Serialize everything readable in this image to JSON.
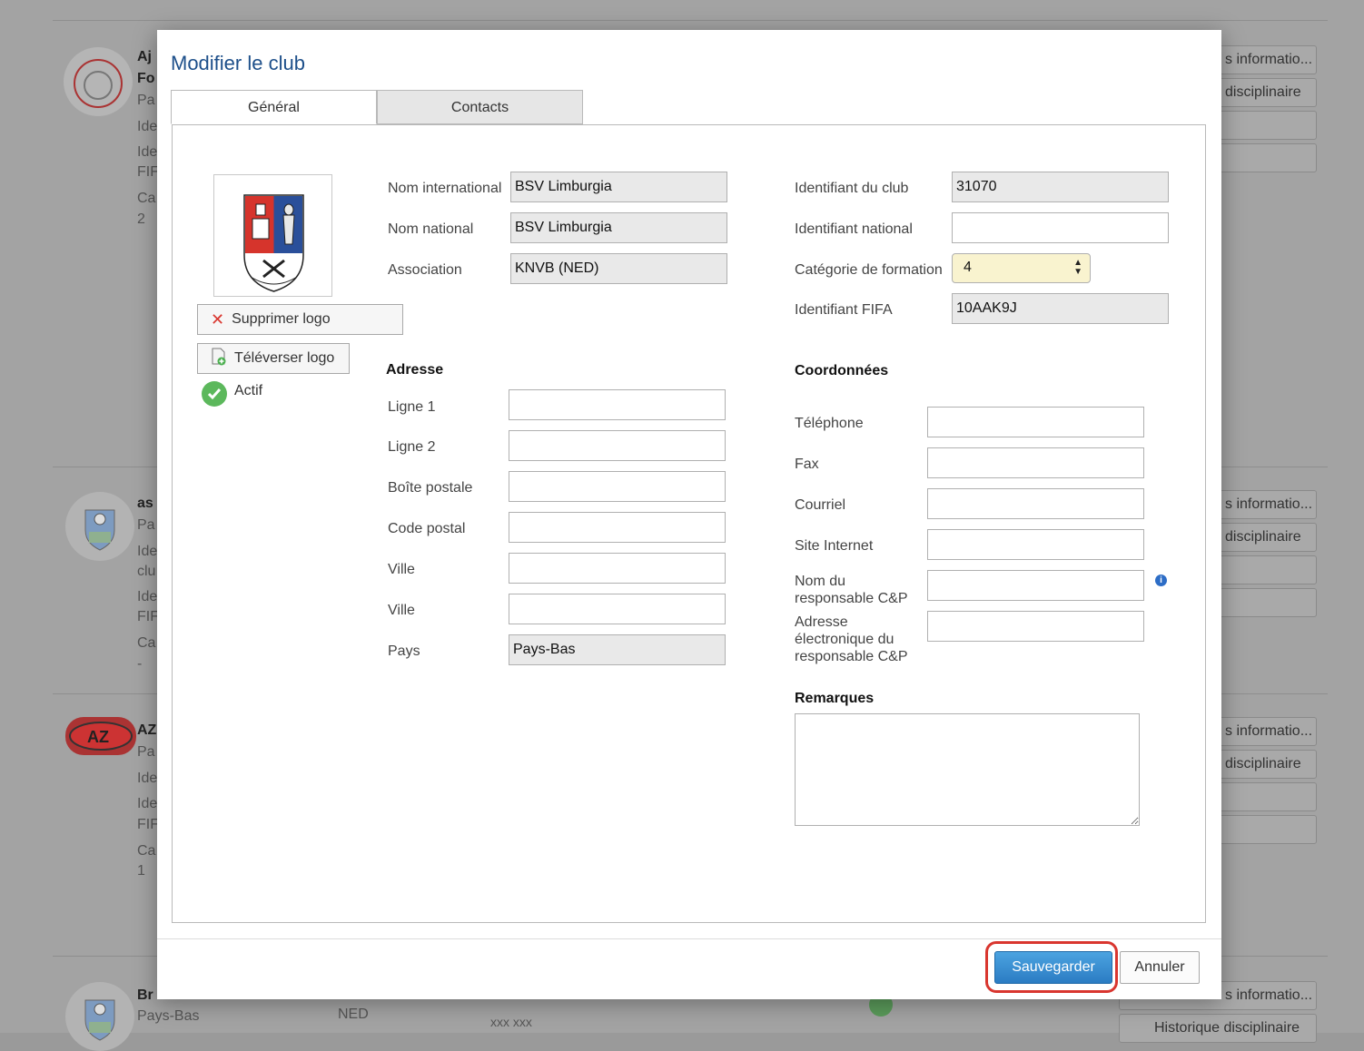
{
  "modal": {
    "title": "Modifier le club",
    "tabs": [
      {
        "label": "Général",
        "active": true
      },
      {
        "label": "Contacts",
        "active": false
      }
    ],
    "logo_actions": {
      "delete_label": "Supprimer logo",
      "upload_label": "Téléverser logo",
      "status_label": "Actif"
    },
    "general": {
      "international_name": {
        "label": "Nom international",
        "value": "BSV Limburgia"
      },
      "national_name": {
        "label": "Nom national",
        "value": "BSV Limburgia"
      },
      "association": {
        "label": "Association",
        "value": "KNVB (NED)"
      }
    },
    "ids": {
      "club_id": {
        "label": "Identifiant du club",
        "value": "31070"
      },
      "national_id": {
        "label": "Identifiant national",
        "value": ""
      },
      "training_category": {
        "label": "Catégorie de formation",
        "value": "4"
      },
      "fifa_id": {
        "label": "Identifiant FIFA",
        "value": "10AAK9J"
      }
    },
    "address": {
      "heading": "Adresse",
      "line1": {
        "label": "Ligne 1",
        "value": ""
      },
      "line2": {
        "label": "Ligne 2",
        "value": ""
      },
      "po_box": {
        "label": "Boîte postale",
        "value": ""
      },
      "postal_code": {
        "label": "Code postal",
        "value": ""
      },
      "city1": {
        "label": "Ville",
        "value": ""
      },
      "city2": {
        "label": "Ville",
        "value": ""
      },
      "country": {
        "label": "Pays",
        "value": "Pays-Bas"
      }
    },
    "contact": {
      "heading": "Coordonnées",
      "phone": {
        "label": "Téléphone",
        "value": ""
      },
      "fax": {
        "label": "Fax",
        "value": ""
      },
      "email": {
        "label": "Courriel",
        "value": ""
      },
      "website": {
        "label": "Site Internet",
        "value": ""
      },
      "cp_name": {
        "label": "Nom du responsable C&P",
        "value": ""
      },
      "cp_email": {
        "label": "Adresse électronique du responsable C&P",
        "value": ""
      }
    },
    "remarks": {
      "heading": "Remarques",
      "value": ""
    },
    "footer": {
      "save_label": "Sauvegarder",
      "cancel_label": "Annuler"
    }
  },
  "background": {
    "rows": [
      {
        "name": "Aj",
        "name_line2": "Fo",
        "meta": [
          "Pa",
          "Ide",
          "Ide",
          "FIF",
          "Ca",
          "2"
        ],
        "buttons": [
          "s informatio...",
          "disciplinaire"
        ]
      },
      {
        "name": "as",
        "meta": [
          "Pa",
          "Ide",
          "clu",
          "Ide",
          "FIF",
          "Ca",
          "-"
        ],
        "buttons": [
          "s informatio...",
          "disciplinaire"
        ]
      },
      {
        "name": "AZ",
        "meta": [
          "Pa",
          "Ide",
          "Ide",
          "FIF",
          "Ca",
          "1"
        ],
        "buttons": [
          "s informatio...",
          "disciplinaire"
        ]
      },
      {
        "name": "Br",
        "country": "Pays-Bas",
        "assoc": "NED",
        "phone": "xxx xxx",
        "buttons": [
          "s informatio...",
          "Historique disciplinaire"
        ]
      }
    ]
  },
  "colors": {
    "accent": "#2b7cc3",
    "title": "#1d4f8a",
    "highlight_ring": "#d9362f",
    "select_bg": "#f9f3cf"
  }
}
